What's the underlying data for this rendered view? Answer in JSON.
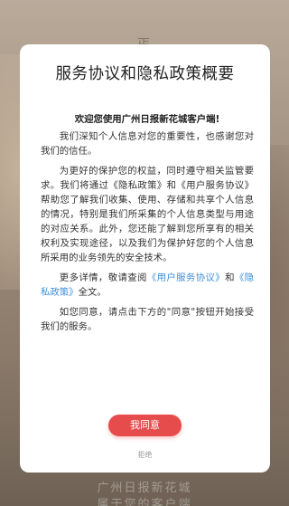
{
  "background": {
    "top_glyph": "丐",
    "bottom_line1": "广州日报新花城",
    "bottom_line2": "属于您的客户端"
  },
  "dialog": {
    "title": "服务协议和隐私政策概要",
    "welcome": "欢迎您使用广州日报新花城客户端!",
    "p1": "我们深知个人信息对您的重要性，也感谢您对我们的信任。",
    "p2": "为更好的保护您的权益，同时遵守相关监管要求。我们将通过《隐私政策》和《用户服务协议》帮助您了解我们收集、使用、存储和共享个人信息的情况，特别是我们所采集的个人信息类型与用途的对应关系。此外，您还能了解到您所享有的相关权利及实现途径，以及我们为保护好您的个人信息所采用的业务领先的安全技术。",
    "p3_prefix": "更多详情，敬请查阅",
    "p3_link1": "《用户服务协议》",
    "p3_middle": "和",
    "p3_link2": "《隐私政策》",
    "p3_suffix": "全文。",
    "p4": "如您同意，请点击下方的\"同意\"按钮开始接受我们的服务。",
    "agree_label": "我同意",
    "reject_label": "拒绝"
  },
  "colors": {
    "accent": "#e74c4c",
    "link": "#3d8fd9"
  }
}
